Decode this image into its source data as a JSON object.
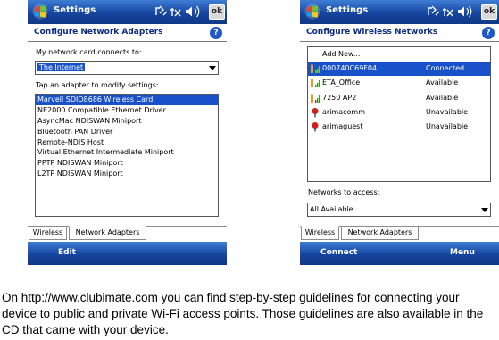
{
  "left_screen": {
    "title": "Settings",
    "ok_label": "ok",
    "header": "Configure Network Adapters",
    "help_label": "?",
    "connects_label": "My network card connects to:",
    "connects_value": "The Internet",
    "tap_label": "Tap an adapter to modify settings:",
    "adapters": [
      "Marvell SDIO8686 Wireless Card",
      "NE2000 Compatible Ethernet Driver",
      "AsyncMac NDISWAN Miniport",
      "Bluetooth PAN Driver",
      "Remote-NDIS Host",
      "Virtual Ethernet Intermediate Miniport",
      "PPTP NDISWAN Miniport",
      "L2TP NDISWAN Miniport"
    ],
    "tabs": [
      "Wireless",
      "Network Adapters"
    ],
    "softkey_left": "Edit"
  },
  "right_screen": {
    "title": "Settings",
    "ok_label": "ok",
    "header": "Configure Wireless Networks",
    "help_label": "?",
    "add_new": "Add New...",
    "networks": [
      {
        "name": "000740C69F04",
        "status": "Connected",
        "icon": "secured-signal-icon"
      },
      {
        "name": "ETA_Office",
        "status": "Available",
        "icon": "secured-signal-icon"
      },
      {
        "name": "7250 AP2",
        "status": "Available",
        "icon": "secured-signal-icon"
      },
      {
        "name": "arimacomm",
        "status": "Unavailable",
        "icon": "unavailable-pin-icon"
      },
      {
        "name": "arimaguest",
        "status": "Unavailable",
        "icon": "unavailable-pin-icon"
      }
    ],
    "access_label": "Networks to access:",
    "access_value": "All Available",
    "tabs": [
      "Wireless",
      "Network Adapters"
    ],
    "softkey_left": "Connect",
    "softkey_right": "Menu"
  },
  "caption": "On http://www.clubimate.com you can find step-by-step guidelines for connecting your device to public and private Wi-Fi access points. Those guidelines are also available in the CD that came with your device.",
  "colors": {
    "titlebar": "#16459f",
    "selection": "#1851c9",
    "header_text": "#0e2c82"
  }
}
